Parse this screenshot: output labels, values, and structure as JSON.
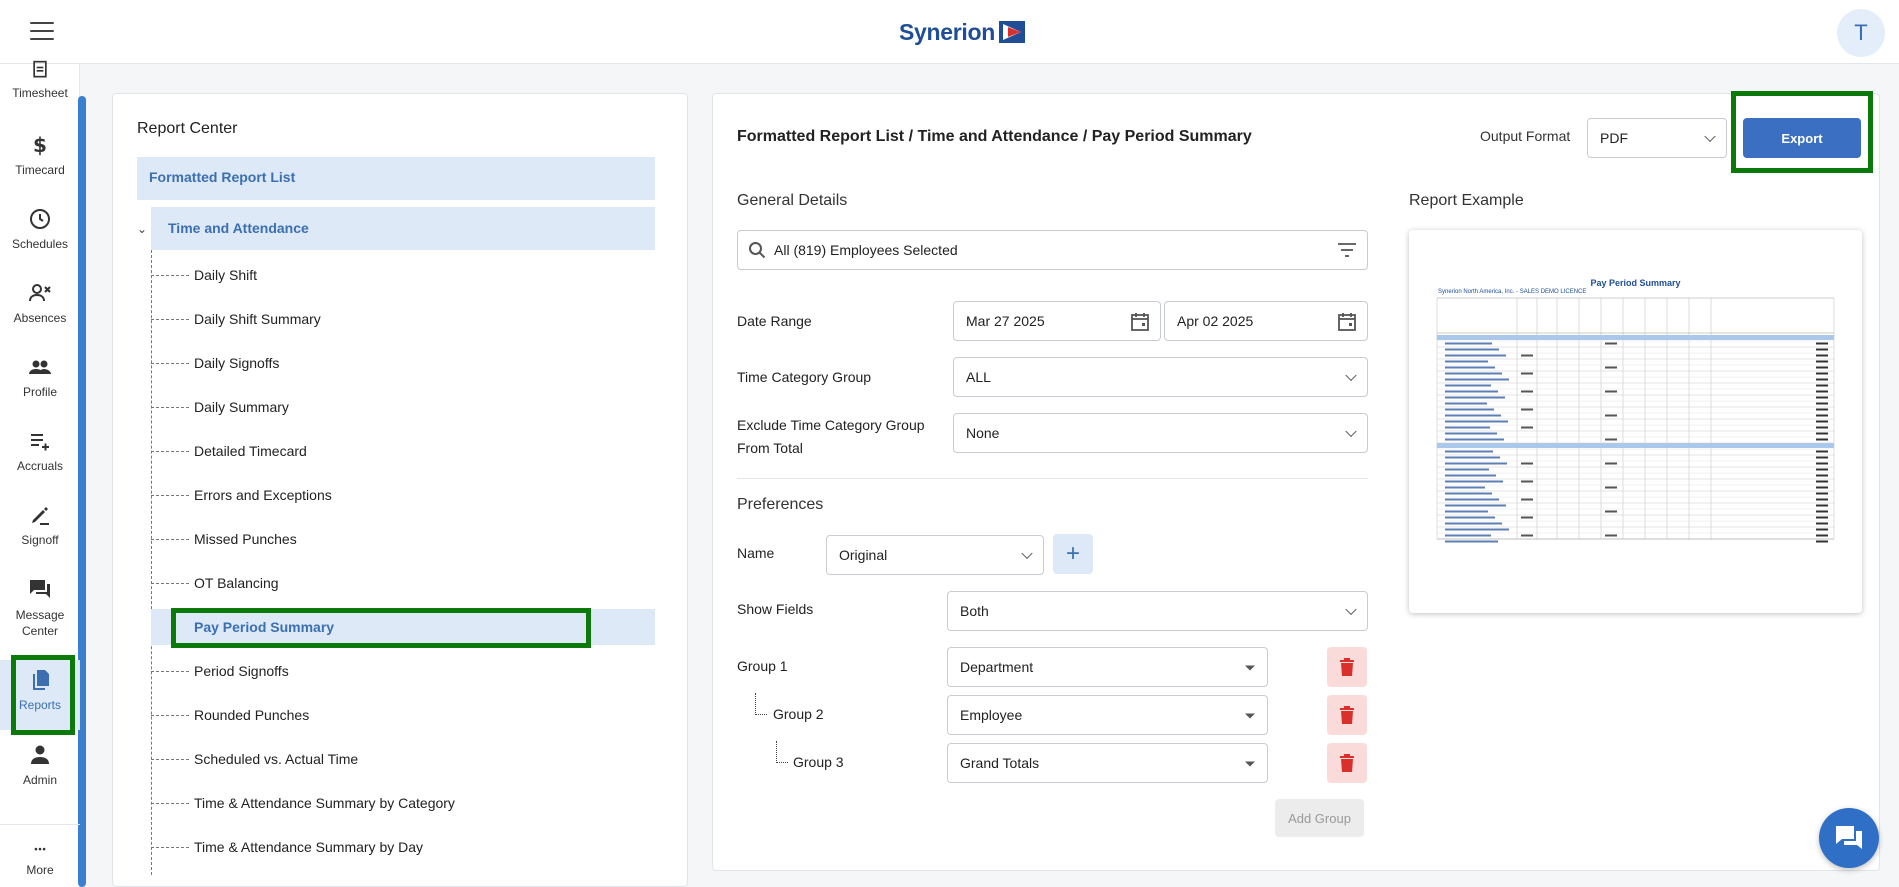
{
  "header": {
    "brand": "Synerion",
    "avatar_initial": "T"
  },
  "sidebar": {
    "items": [
      {
        "label": "Timesheet",
        "icon": "timesheet-icon"
      },
      {
        "label": "Timecard",
        "icon": "dollar-icon"
      },
      {
        "label": "Schedules",
        "icon": "clock-icon"
      },
      {
        "label": "Absences",
        "icon": "person-x-icon"
      },
      {
        "label": "Profile",
        "icon": "people-icon"
      },
      {
        "label": "Accruals",
        "icon": "list-icon"
      },
      {
        "label": "Signoff",
        "icon": "pen-icon"
      },
      {
        "label": "Message Center",
        "icon": "chat-icon"
      },
      {
        "label": "Reports",
        "icon": "reports-icon"
      },
      {
        "label": "Admin",
        "icon": "person-icon"
      },
      {
        "label": "More",
        "icon": "more-icon"
      }
    ]
  },
  "report_center": {
    "title": "Report Center",
    "root": "Formatted Report List",
    "group": "Time and Attendance",
    "reports": [
      "Daily Shift",
      "Daily Shift Summary",
      "Daily Signoffs",
      "Daily Summary",
      "Detailed Timecard",
      "Errors and Exceptions",
      "Missed Punches",
      "OT Balancing",
      "Pay Period Summary",
      "Period Signoffs",
      "Rounded Punches",
      "Scheduled vs. Actual Time",
      "Time & Attendance Summary by Category",
      "Time & Attendance Summary by Day"
    ],
    "selected": "Pay Period Summary"
  },
  "main": {
    "breadcrumb": "Formatted Report List / Time and Attendance / Pay Period Summary",
    "output_format_label": "Output Format",
    "output_format_value": "PDF",
    "export_label": "Export",
    "general_details": "General Details",
    "employees": "All (819) Employees Selected",
    "date_range_label": "Date Range",
    "date_from": "Mar 27 2025",
    "date_to": "Apr 02 2025",
    "tcg_label": "Time Category Group",
    "tcg_value": "ALL",
    "exclude_label_1": "Exclude Time Category Group",
    "exclude_label_2": "From Total",
    "exclude_value": "None",
    "preferences": "Preferences",
    "name_label": "Name",
    "name_value": "Original",
    "show_fields_label": "Show Fields",
    "show_fields_value": "Both",
    "groups": [
      {
        "label": "Group 1",
        "value": "Department"
      },
      {
        "label": "Group 2",
        "value": "Employee"
      },
      {
        "label": "Group 3",
        "value": "Grand Totals"
      }
    ],
    "add_group": "Add Group",
    "report_example": "Report Example"
  },
  "preview": {
    "title": "Pay Period Summary",
    "company": "Synerion North America, Inc. - SALES DEMO LICENCE",
    "colors": {
      "header_band": "#a9c8ec",
      "title": "#1f4e96"
    }
  },
  "colors": {
    "accent": "#3a6fc1",
    "highlight": "#0b7a0b",
    "selected_bg": "#dde9f7",
    "delete_bg": "#fbdada",
    "delete_icon": "#d9302c"
  }
}
